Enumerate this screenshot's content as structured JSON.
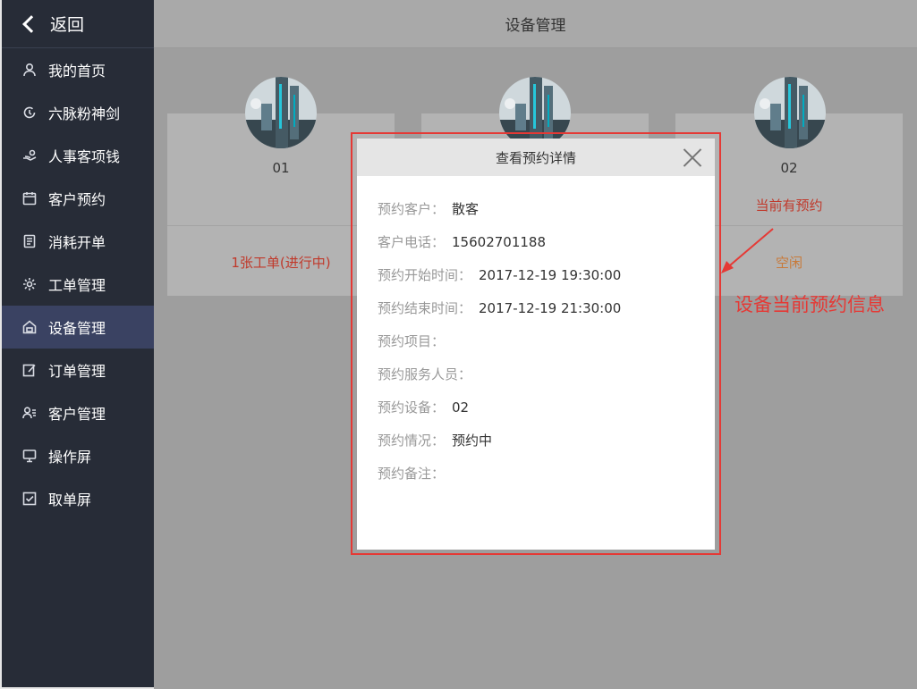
{
  "back": {
    "label": "返回"
  },
  "header": {
    "title": "设备管理"
  },
  "sidebar": {
    "items": [
      {
        "label": "我的首页",
        "icon": "user-icon"
      },
      {
        "label": "六脉粉神剑",
        "icon": "refresh-icon"
      },
      {
        "label": "人事客项钱",
        "icon": "hand-coin-icon"
      },
      {
        "label": "客户预约",
        "icon": "calendar-icon"
      },
      {
        "label": "消耗开单",
        "icon": "document-icon"
      },
      {
        "label": "工单管理",
        "icon": "gear-icon"
      },
      {
        "label": "设备管理",
        "icon": "device-icon",
        "active": true
      },
      {
        "label": "订单管理",
        "icon": "edit-icon"
      },
      {
        "label": "客户管理",
        "icon": "user-list-icon"
      },
      {
        "label": "操作屏",
        "icon": "monitor-icon"
      },
      {
        "label": "取单屏",
        "icon": "checkbox-icon"
      }
    ]
  },
  "devices": [
    {
      "name": "01",
      "sub": "",
      "status": "1张工单(进行中)",
      "status_color": "#c0392b"
    },
    {
      "name": "",
      "sub": "",
      "status": ""
    },
    {
      "name": "02",
      "sub": "当前有预约",
      "status": "空闲",
      "status_color": "#c87a3a"
    }
  ],
  "modal": {
    "title": "查看预约详情",
    "fields": [
      {
        "label": "预约客户：",
        "value": "散客"
      },
      {
        "label": "客户电话：",
        "value": "15602701188"
      },
      {
        "label": "预约开始时间：",
        "value": "2017-12-19 19:30:00"
      },
      {
        "label": "预约结束时间：",
        "value": "2017-12-19 21:30:00"
      },
      {
        "label": "预约项目：",
        "value": ""
      },
      {
        "label": "预约服务人员：",
        "value": ""
      },
      {
        "label": "预约设备：",
        "value": "02"
      },
      {
        "label": "预约情况：",
        "value": "预约中"
      },
      {
        "label": "预约备注：",
        "value": ""
      }
    ]
  },
  "annotation": {
    "text": "设备当前预约信息",
    "color": "#e53935"
  }
}
